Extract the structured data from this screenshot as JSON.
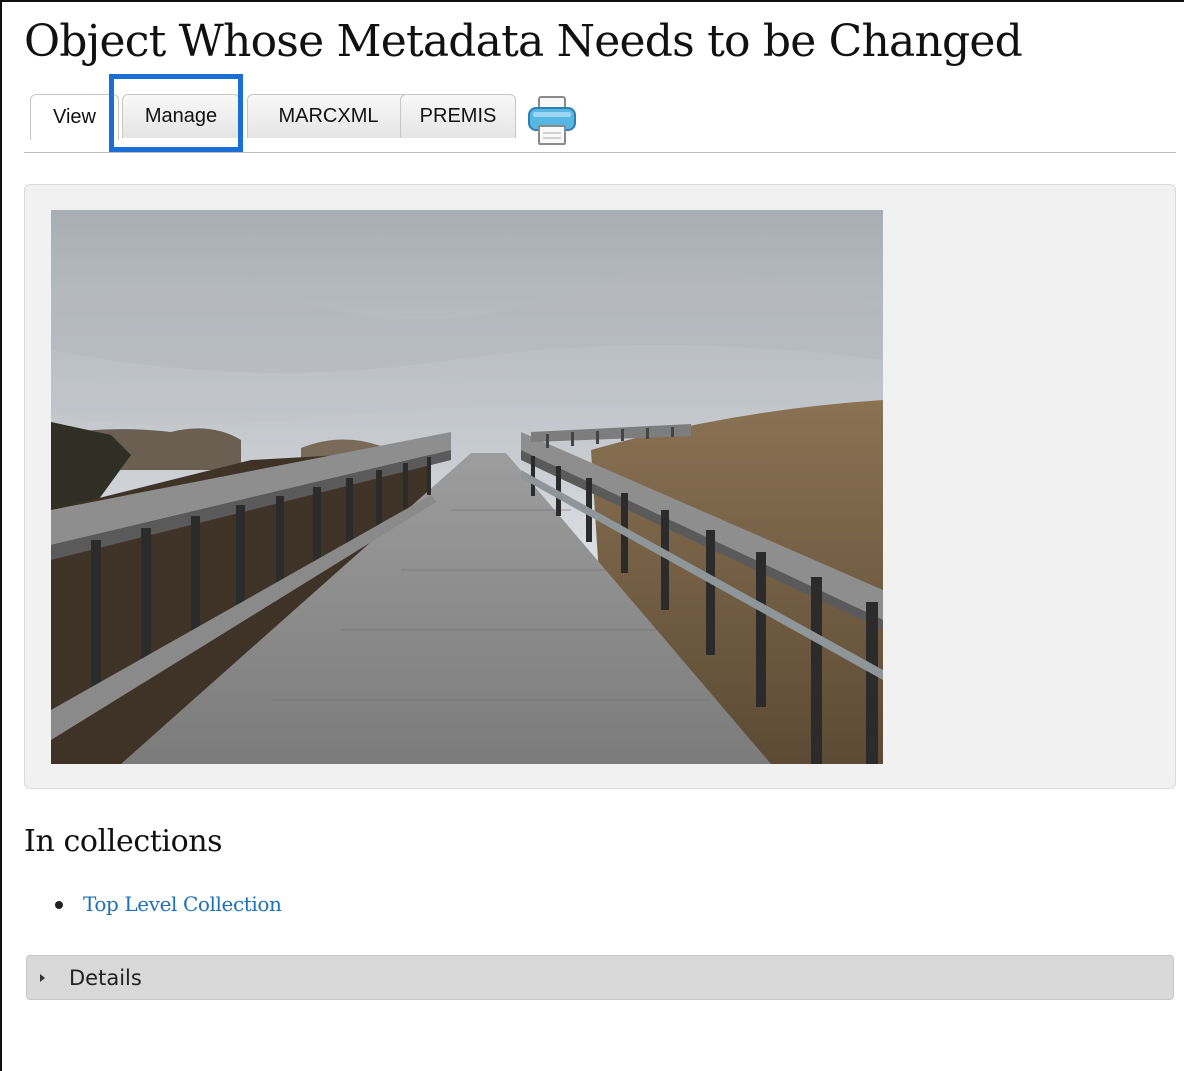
{
  "page": {
    "title": "Object Whose Metadata Needs to be Changed"
  },
  "tabs": [
    {
      "label": "View",
      "active": true
    },
    {
      "label": "Manage",
      "active": false,
      "highlighted": true
    },
    {
      "label": "MARCXML",
      "active": false
    },
    {
      "label": "PREMIS",
      "active": false
    }
  ],
  "print": {
    "icon": "printer-icon"
  },
  "highlight": {
    "color": "#1a6fd6"
  },
  "image": {
    "subject": "boardwalk-photo"
  },
  "collections": {
    "heading": "In collections",
    "items": [
      {
        "label": "Top Level Collection"
      }
    ],
    "link_color": "#1f6fb4"
  },
  "details": {
    "label": "Details",
    "expanded": false
  }
}
